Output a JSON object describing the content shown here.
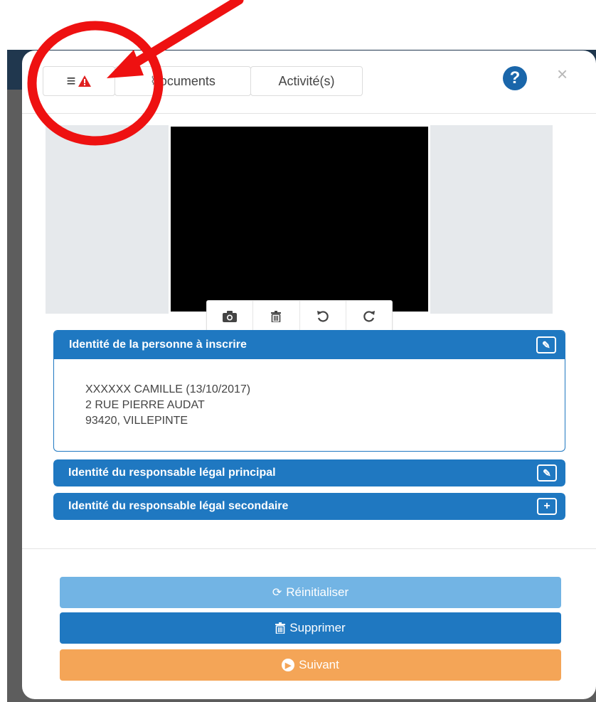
{
  "header": {
    "tabs": [
      {
        "label": ""
      },
      {
        "label": "ocuments"
      },
      {
        "label": "Activité(s)"
      }
    ],
    "help_glyph": "?",
    "close_glyph": "×",
    "icons": {
      "menu": "hamburger-icon",
      "warning": "warning-triangle-icon",
      "documents": "paperclip-icon",
      "help": "question-circle-icon",
      "close": "close-icon"
    }
  },
  "photo": {
    "tools": [
      "camera-icon",
      "trash-icon",
      "rotate-left-icon",
      "rotate-right-icon"
    ]
  },
  "panels": [
    {
      "title": "Identité de la personne à inscrire",
      "action_icon": "edit-icon",
      "lines": [
        "XXXXXX CAMILLE (13/10/2017)",
        "2 RUE PIERRE AUDAT",
        "93420, VILLEPINTE"
      ]
    },
    {
      "title": "Identité du responsable légal principal",
      "action_icon": "edit-icon"
    },
    {
      "title": "Identité du responsable légal secondaire",
      "action_icon": "plus-icon"
    }
  ],
  "actions": {
    "reset_label": "Réinitialiser",
    "delete_label": "Supprimer",
    "next_label": "Suivant"
  },
  "colors": {
    "primary": "#1f78c1",
    "primary_light": "#72b4e4",
    "warning": "#f4a557",
    "alert_red": "#e02020",
    "annotation_red": "#ee1111"
  }
}
